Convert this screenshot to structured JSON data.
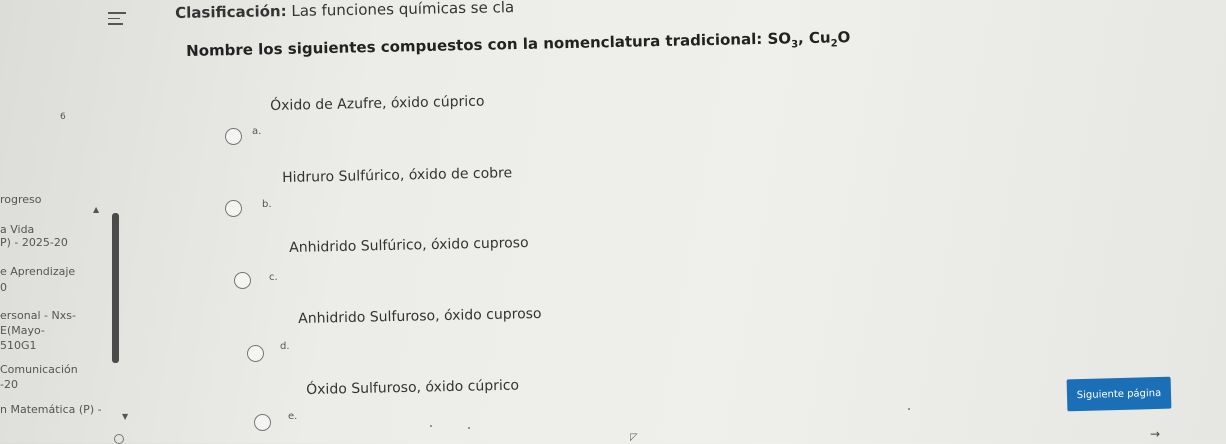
{
  "header": {
    "title_bold": "Clasificación:",
    "title_rest": " Las funciones químicas se cla"
  },
  "question": {
    "text": "Nombre los siguientes compuestos con la nomenclatura tradicional: SO",
    "sub1": "3",
    "mid": ", Cu",
    "sub2": "2",
    "end": "O"
  },
  "side_number": "6",
  "sidebar": {
    "items": [
      "rogreso",
      "a Vida",
      "P) - 2025-20",
      "e Aprendizaje",
      "0",
      "ersonal - Nxs-",
      "E(Mayo-",
      "510G1",
      "Comunicación",
      "-20",
      "n Matemática (P) -"
    ]
  },
  "options": [
    {
      "letter": "a.",
      "text": "Óxido de Azufre, óxido cúprico"
    },
    {
      "letter": "b.",
      "text": "Hidruro Sulfúrico, óxido de cobre"
    },
    {
      "letter": "c.",
      "text": "Anhidrido Sulfúrico, óxido cuproso"
    },
    {
      "letter": "d.",
      "text": "Anhidrido Sulfuroso, óxido cuproso"
    },
    {
      "letter": "e.",
      "text": "Óxido Sulfuroso, óxido cúprico"
    }
  ],
  "next_button": {
    "label": "Siguiente página"
  },
  "icons": {
    "menu": "hamburger-menu-icon",
    "arrow": "arrow-right-icon"
  }
}
